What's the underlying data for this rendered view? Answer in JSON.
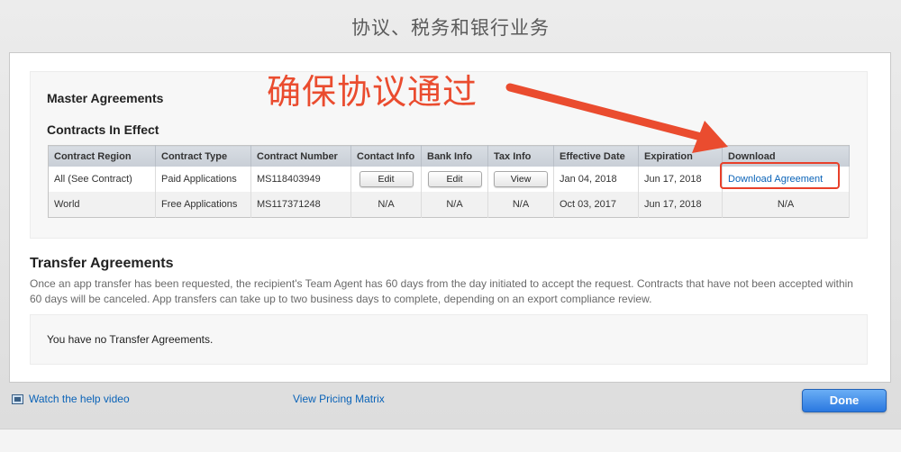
{
  "window": {
    "title": "协议、税务和银行业务"
  },
  "annotation": {
    "text": "确保协议通过",
    "color": "#ea4c2f"
  },
  "master": {
    "title": "Master Agreements",
    "contracts_title": "Contracts In Effect",
    "columns": [
      "Contract Region",
      "Contract Type",
      "Contract Number",
      "Contact Info",
      "Bank Info",
      "Tax Info",
      "Effective Date",
      "Expiration",
      "Download"
    ],
    "rows": [
      {
        "region": "All (See Contract)",
        "type": "Paid Applications",
        "number": "MS118403949",
        "contact": "Edit",
        "bank": "Edit",
        "tax": "View",
        "effective": "Jan 04, 2018",
        "expiration": "Jun 17, 2018",
        "download": "Download Agreement"
      },
      {
        "region": "World",
        "type": "Free Applications",
        "number": "MS117371248",
        "contact": "N/A",
        "bank": "N/A",
        "tax": "N/A",
        "effective": "Oct 03, 2017",
        "expiration": "Jun 17, 2018",
        "download": "N/A"
      }
    ]
  },
  "transfer": {
    "title": "Transfer Agreements",
    "description": "Once an app transfer has been requested, the recipient's Team Agent has 60 days from the day initiated to accept the request. Contracts that have not been accepted within 60 days will be canceled. App transfers can take up to two business days to complete, depending on an export compliance review.",
    "empty_text": "You have no Transfer Agreements."
  },
  "footer": {
    "help_link": "Watch the help video",
    "help_icon": "video-icon",
    "pricing_link": "View Pricing Matrix",
    "done_label": "Done"
  },
  "colors": {
    "accent": "#2a78e0",
    "link": "#0a63b8",
    "annotation": "#e8402a"
  }
}
